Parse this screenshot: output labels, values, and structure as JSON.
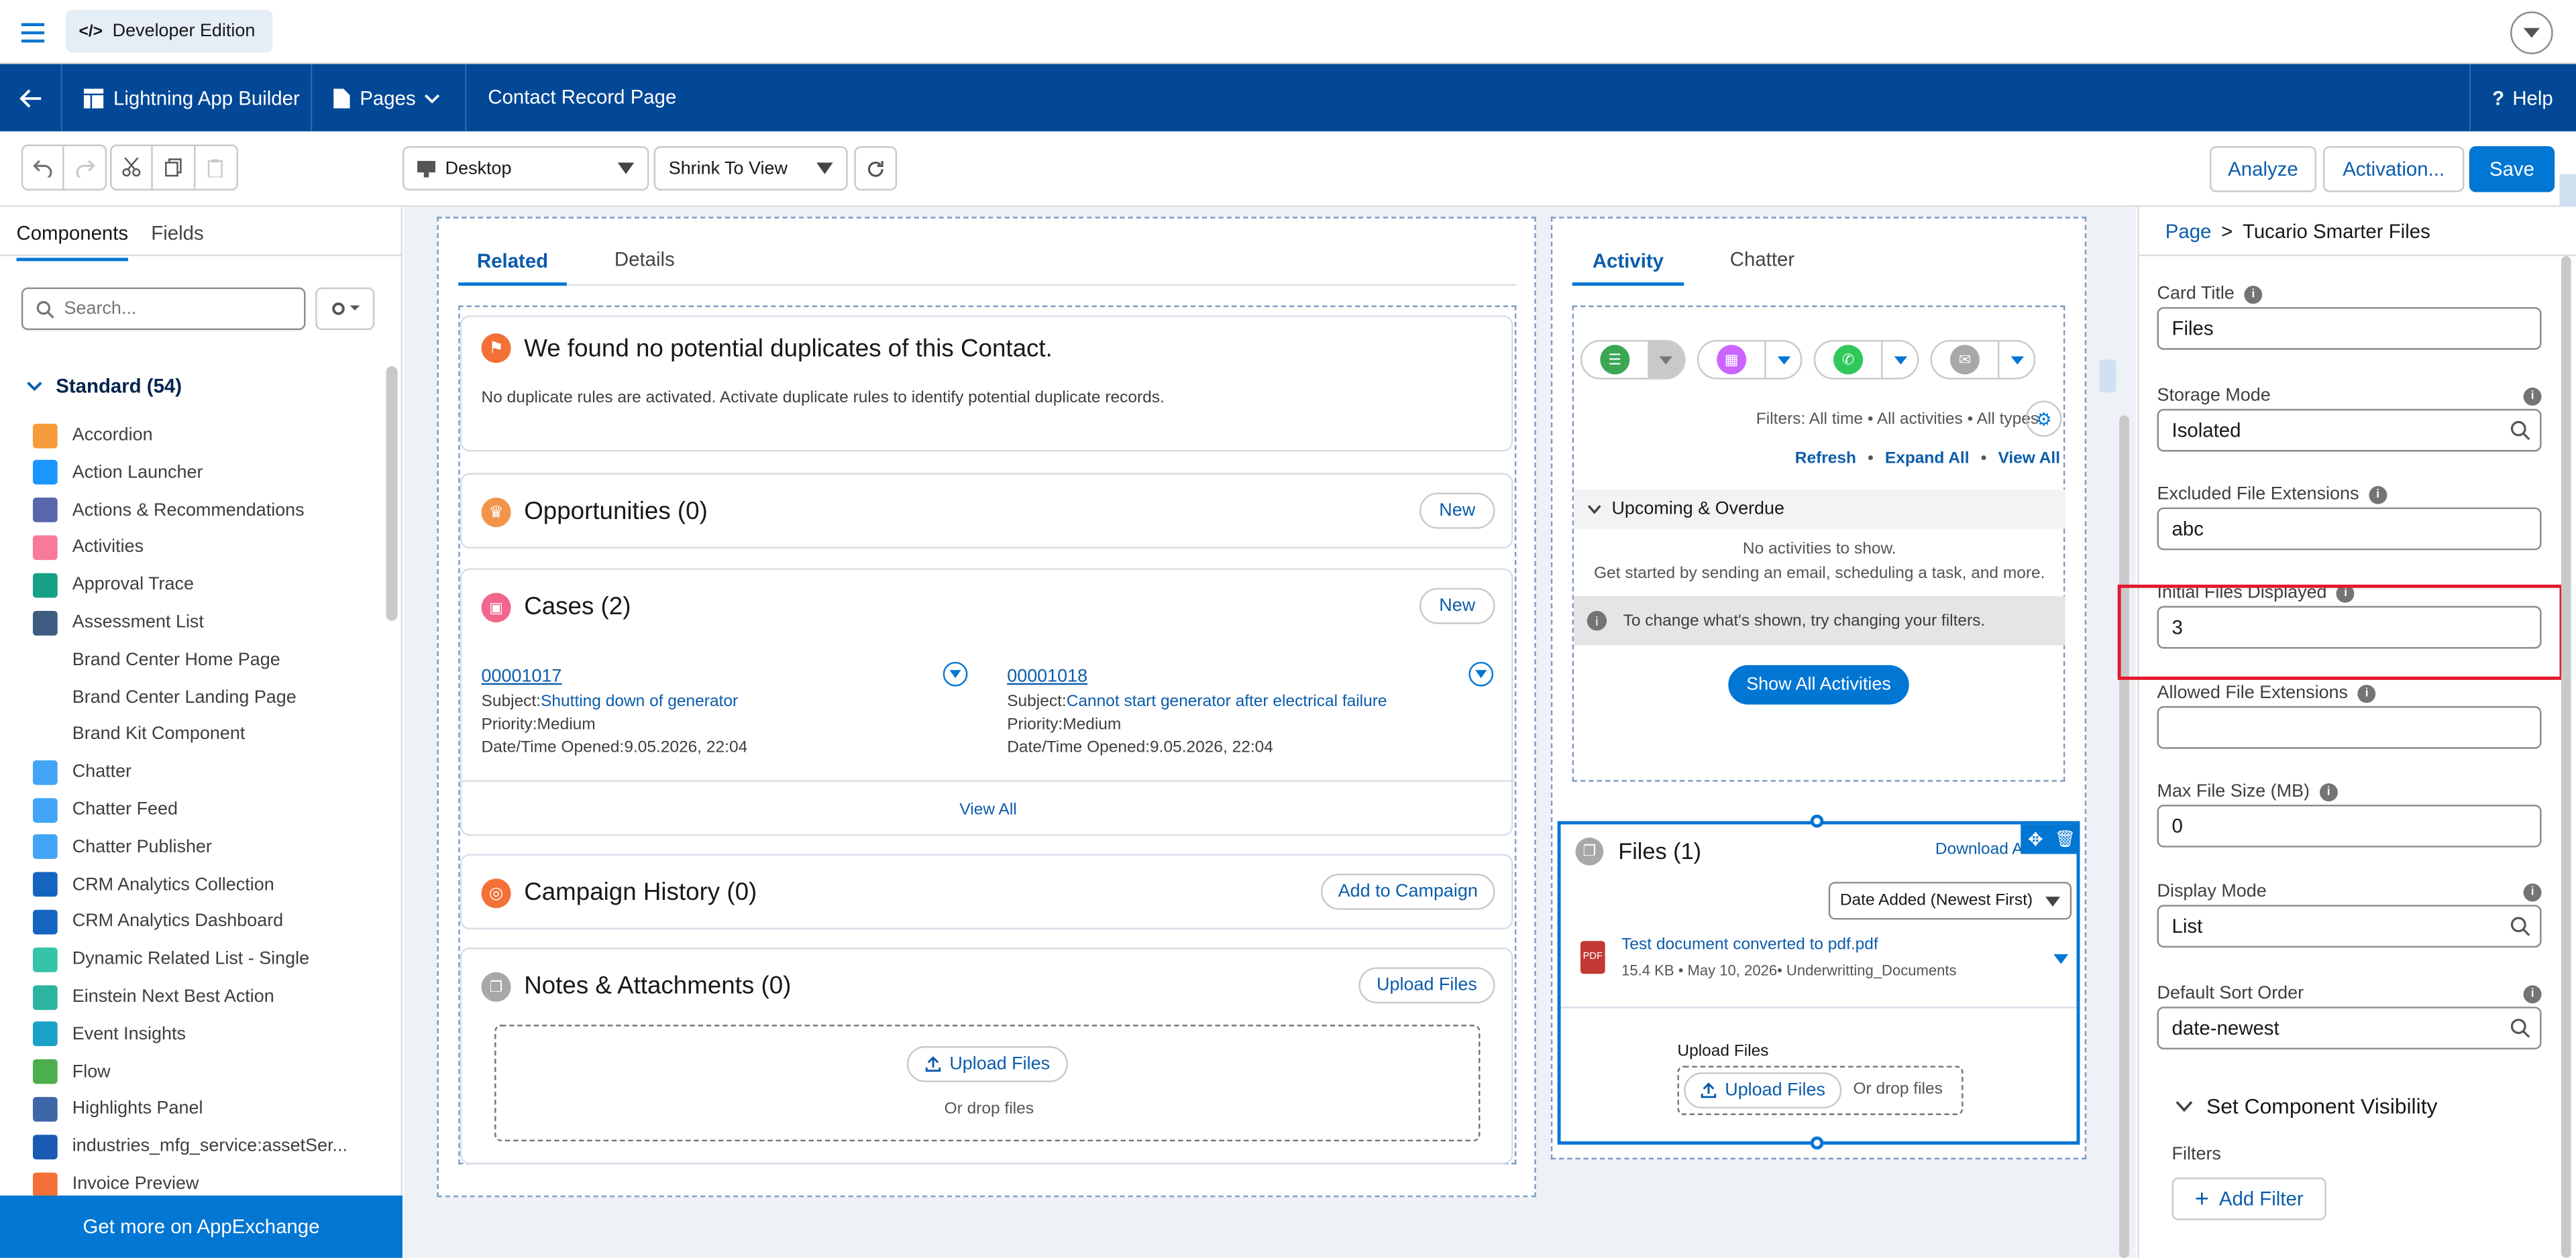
{
  "topbar": {
    "edition": "Developer Edition"
  },
  "builder_header": {
    "app": "Lightning App Builder",
    "pages": "Pages",
    "page_name": "Contact Record Page",
    "help": "Help"
  },
  "toolbar": {
    "device": "Desktop",
    "view": "Shrink To View",
    "analyze": "Analyze",
    "activation": "Activation...",
    "save": "Save"
  },
  "sidebar": {
    "tabs": [
      "Components",
      "Fields"
    ],
    "search_placeholder": "Search...",
    "section": "Standard (54)",
    "items": [
      {
        "label": "Accordion",
        "color": "#f59b3a"
      },
      {
        "label": "Action Launcher",
        "color": "#1b96ff"
      },
      {
        "label": "Actions & Recommendations",
        "color": "#5867a9"
      },
      {
        "label": "Activities",
        "color": "#f77a99"
      },
      {
        "label": "Approval Trace",
        "color": "#16a085"
      },
      {
        "label": "Assessment List",
        "color": "#3e5b80"
      },
      {
        "label": "Brand Center Home Page",
        "color": ""
      },
      {
        "label": "Brand Center Landing Page",
        "color": ""
      },
      {
        "label": "Brand Kit Component",
        "color": ""
      },
      {
        "label": "Chatter",
        "color": "#42a5f5"
      },
      {
        "label": "Chatter Feed",
        "color": "#42a5f5"
      },
      {
        "label": "Chatter Publisher",
        "color": "#42a5f5"
      },
      {
        "label": "CRM Analytics Collection",
        "color": "#1565c0"
      },
      {
        "label": "CRM Analytics Dashboard",
        "color": "#1565c0"
      },
      {
        "label": "Dynamic Related List - Single",
        "color": "#35c4a7"
      },
      {
        "label": "Einstein Next Best Action",
        "color": "#2bb5a0"
      },
      {
        "label": "Event Insights",
        "color": "#1aa1c8"
      },
      {
        "label": "Flow",
        "color": "#4cae4c"
      },
      {
        "label": "Highlights Panel",
        "color": "#3e67a8"
      },
      {
        "label": "industries_mfg_service:assetSer...",
        "color": "#1b5ab3"
      },
      {
        "label": "Invoice Preview",
        "color": "#f37036"
      }
    ],
    "appexchange": "Get more on AppExchange"
  },
  "canvas": {
    "left_tabs": [
      "Related",
      "Details"
    ],
    "duplicates": {
      "title": "We found no potential duplicates of this Contact.",
      "body": "No duplicate rules are activated. Activate duplicate rules to identify potential duplicate records."
    },
    "opportunities": {
      "title": "Opportunities (0)",
      "new": "New"
    },
    "cases": {
      "title": "Cases (2)",
      "new": "New",
      "view_all": "View All",
      "items": [
        {
          "number": "00001017",
          "subject_label": "Subject:",
          "subject": "Shutting down of generator",
          "priority": "Priority:Medium",
          "opened": "Date/Time Opened:9.05.2026, 22:04"
        },
        {
          "number": "00001018",
          "subject_label": "Subject:",
          "subject": "Cannot start generator after electrical failure",
          "priority": "Priority:Medium",
          "opened": "Date/Time Opened:9.05.2026, 22:04"
        }
      ]
    },
    "campaign": {
      "title": "Campaign History (0)",
      "button": "Add to Campaign"
    },
    "notes": {
      "title": "Notes & Attachments (0)",
      "button": "Upload Files",
      "upload": "Upload Files",
      "drop": "Or drop files"
    },
    "right_tabs": [
      "Activity",
      "Chatter"
    ],
    "activity": {
      "filters": "Filters: All time • All activities • All types",
      "refresh": "Refresh",
      "expand": "Expand All",
      "view_all": "View All",
      "upcoming": "Upcoming & Overdue",
      "no_activities": "No activities to show.",
      "get_started": "Get started by sending an email, scheduling a task, and more.",
      "info": "To change what's shown, try changing your filters.",
      "show_all": "Show All Activities"
    },
    "files": {
      "title": "Files (1)",
      "download": "Download All",
      "sort": "Date Added (Newest First)",
      "file_name": "Test document converted to pdf.pdf",
      "file_meta": "15.4 KB • May 10, 2026• Underwritting_Documents",
      "upload_label": "Upload Files",
      "upload": "Upload Files",
      "drop": "Or drop files"
    }
  },
  "properties": {
    "breadcrumb_page": "Page",
    "breadcrumb_sep": ">",
    "breadcrumb_current": "Tucario Smarter Files",
    "card_title_label": "Card Title",
    "card_title": "Files",
    "storage_label": "Storage Mode",
    "storage": "Isolated",
    "excluded_label": "Excluded File Extensions",
    "excluded": "abc",
    "initial_label": "Initial Files Displayed",
    "initial": "3",
    "allowed_label": "Allowed File Extensions",
    "allowed": "",
    "maxsize_label": "Max File Size (MB)",
    "maxsize": "0",
    "display_label": "Display Mode",
    "display": "List",
    "sort_label": "Default Sort Order",
    "sort": "date-newest",
    "visibility": "Set Component Visibility",
    "filters": "Filters",
    "add_filter": "Add Filter",
    "highlight_color": "#e3182d"
  }
}
